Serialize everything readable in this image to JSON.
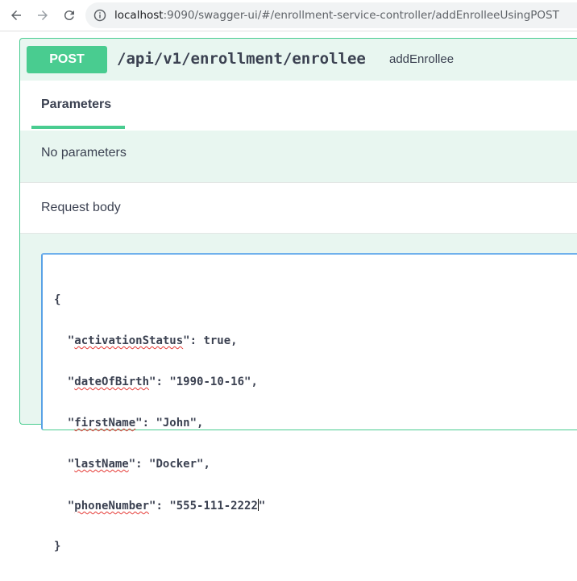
{
  "browser": {
    "url_host": "localhost",
    "url_rest": ":9090/swagger-ui/#/enrollment-service-controller/addEnrolleeUsingPOST"
  },
  "operation": {
    "method": "POST",
    "path": "/api/v1/enrollment/enrollee",
    "summary": "addEnrollee",
    "tab_label": "Parameters",
    "no_params_text": "No parameters",
    "request_body_label": "Request body",
    "colors": {
      "accent": "#49cc90",
      "background": "#e8f6f0",
      "text": "#3b4151"
    }
  },
  "request_body": {
    "open": "{",
    "close": "}",
    "lines": [
      {
        "key": "activationStatus",
        "value": "true",
        "comma": ","
      },
      {
        "key": "dateOfBirth",
        "value": "\"1990-10-16\"",
        "comma": ","
      },
      {
        "key": "firstName",
        "value": "\"John\"",
        "comma": ","
      },
      {
        "key": "lastName",
        "value": "\"Docker\"",
        "comma": ","
      },
      {
        "key": "phoneNumber",
        "value_before_cursor": "\"555-111-2222",
        "value_after_cursor": "\"",
        "comma": ""
      }
    ]
  }
}
